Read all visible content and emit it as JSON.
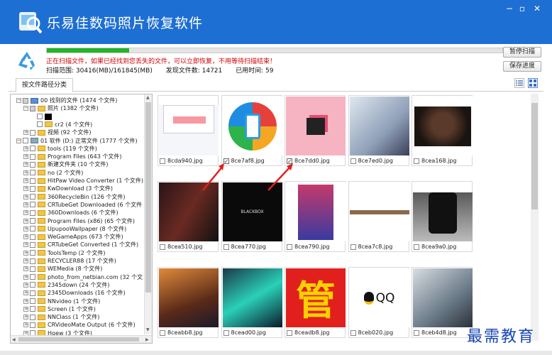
{
  "window": {
    "title": "乐易佳数码照片恢复软件",
    "accent": "#1e6fd3",
    "controls": [
      "minimize-icon",
      "restore-icon",
      "close-icon"
    ]
  },
  "status": {
    "progress": 0.18,
    "message": "正在扫描文件，如果已经找到您丢失的文件，可以立即恢复，不用等待扫描结束！",
    "scan_range": "扫描范围: 30416(MB)/161845(MB)",
    "found_files": "发现文件数: 14721",
    "elapsed": "已用时间: 59",
    "pause_button": "暂停扫描",
    "save_button": "保存进度"
  },
  "toolbar": {
    "tab_label": "按文件路径分类",
    "view_list_icon": "list-view-icon",
    "view_grid_icon": "grid-view-icon"
  },
  "tree": [
    {
      "label": "00 找到的文件 (1474 个文件)",
      "level": 0,
      "expander": "−",
      "checked": true,
      "icon": "found-icon"
    },
    {
      "label": "照片   (1382 个文件)",
      "level": 1,
      "expander": "−",
      "checked": true,
      "icon": "folder"
    },
    {
      "label": "",
      "level": 2,
      "expander": "",
      "checked": false,
      "icon": "black"
    },
    {
      "label": "cr2    (4 个文件)",
      "level": 2,
      "expander": "",
      "checked": false,
      "icon": "folder"
    },
    {
      "label": "视频   (92 个文件)",
      "level": 1,
      "expander": "+",
      "checked": false,
      "icon": "folder"
    },
    {
      "label": "01 软件 (D:) 正常文件 (1777 个文件)",
      "level": 0,
      "expander": "−",
      "checked": false,
      "icon": "hdd"
    },
    {
      "label": "tools  (119 个文件)",
      "level": 1,
      "expander": "+",
      "checked": false,
      "icon": "folder"
    },
    {
      "label": "Program Files  (643 个文件)",
      "level": 1,
      "expander": "+",
      "checked": false,
      "icon": "folder"
    },
    {
      "label": "新建文件夹  (10 个文件)",
      "level": 1,
      "expander": "+",
      "checked": false,
      "icon": "folder"
    },
    {
      "label": "no  (2 个文件)",
      "level": 1,
      "expander": "+",
      "checked": false,
      "icon": "folder"
    },
    {
      "label": "HitPaw Video Converter  (1 个文件)",
      "level": 1,
      "expander": "+",
      "checked": false,
      "icon": "folder"
    },
    {
      "label": "KwDownload  (3 个文件)",
      "level": 1,
      "expander": "+",
      "checked": false,
      "icon": "folder"
    },
    {
      "label": "360RecycleBin  (126 个文件)",
      "level": 1,
      "expander": "+",
      "checked": false,
      "icon": "folder"
    },
    {
      "label": "CRTubeGet Downloaded  (6 个文件",
      "level": 1,
      "expander": "+",
      "checked": false,
      "icon": "folder"
    },
    {
      "label": "360Downloads  (6 个文件)",
      "level": 1,
      "expander": "+",
      "checked": false,
      "icon": "folder"
    },
    {
      "label": "Program Files (x86)  (65 个文件)",
      "level": 1,
      "expander": "+",
      "checked": false,
      "icon": "folder"
    },
    {
      "label": "UpupooWallpaper  (8 个文件)",
      "level": 1,
      "expander": "+",
      "checked": false,
      "icon": "folder"
    },
    {
      "label": "WeGameApps  (673 个文件)",
      "level": 1,
      "expander": "+",
      "checked": false,
      "icon": "folder"
    },
    {
      "label": "CRTubeGet Converted  (1 个文件)",
      "level": 1,
      "expander": "+",
      "checked": false,
      "icon": "folder"
    },
    {
      "label": "ToolsTemp  (2 个文件)",
      "level": 1,
      "expander": "+",
      "checked": false,
      "icon": "folder"
    },
    {
      "label": "RECYCLER88  (17 个文件)",
      "level": 1,
      "expander": "+",
      "checked": false,
      "icon": "folder"
    },
    {
      "label": "WEMedia  (8 个文件)",
      "level": 1,
      "expander": "+",
      "checked": false,
      "icon": "folder"
    },
    {
      "label": "photo_from_netbian.com  (32 个文",
      "level": 1,
      "expander": "+",
      "checked": false,
      "icon": "folder"
    },
    {
      "label": "2345down  (24 个文件)",
      "level": 1,
      "expander": "+",
      "checked": false,
      "icon": "folder"
    },
    {
      "label": "2345Downloads  (16 个文件)",
      "level": 1,
      "expander": "+",
      "checked": false,
      "icon": "folder"
    },
    {
      "label": "NNvideo  (1 个文件)",
      "level": 1,
      "expander": "+",
      "checked": false,
      "icon": "folder"
    },
    {
      "label": "Screen  (1 个文件)",
      "level": 1,
      "expander": "+",
      "checked": false,
      "icon": "folder"
    },
    {
      "label": "NNClass  (1 个文件)",
      "level": 1,
      "expander": "+",
      "checked": false,
      "icon": "folder"
    },
    {
      "label": "CRVideoMate Output  (6 个文件)",
      "level": 1,
      "expander": "+",
      "checked": false,
      "icon": "folder"
    },
    {
      "label": "Hgew  (3 个文件)",
      "level": 1,
      "expander": "+",
      "checked": false,
      "icon": "folder"
    }
  ],
  "thumbnails": [
    {
      "name": "8cda940.jpg",
      "checked": false,
      "art": "screenshot"
    },
    {
      "name": "8ce7af8.jpg",
      "checked": true,
      "art": "phone-logo"
    },
    {
      "name": "8ce7dd0.jpg",
      "checked": true,
      "art": "pink-box"
    },
    {
      "name": "8ce7ed0.jpg",
      "checked": false,
      "art": "fantasy-light"
    },
    {
      "name": "8cea168.jpg",
      "checked": false,
      "art": "portrait"
    },
    {
      "name": "8cea510.jpg",
      "checked": false,
      "art": "dark-warrior"
    },
    {
      "name": "8cea770.jpg",
      "checked": false,
      "art": "black-logo"
    },
    {
      "name": "8cea790.jpg",
      "checked": false,
      "art": "phone-screen"
    },
    {
      "name": "8cea7c8.jpg",
      "checked": false,
      "art": "white-strip"
    },
    {
      "name": "8cea9a0.jpg",
      "checked": false,
      "art": "iphone"
    },
    {
      "name": "8ceabb8.jpg",
      "checked": false,
      "art": "battle"
    },
    {
      "name": "8cead00.jpg",
      "checked": false,
      "art": "teal-hero"
    },
    {
      "name": "8ceadb8.jpg",
      "checked": false,
      "art": "guan"
    },
    {
      "name": "8ceb020.jpg",
      "checked": false,
      "art": "qq"
    },
    {
      "name": "8ceb4d8.jpg",
      "checked": false,
      "art": "white-hero"
    }
  ],
  "art_text": {
    "guan": "管",
    "qq": "QQ",
    "black_logo": "BLACKBOX"
  },
  "watermark": "最需教育"
}
